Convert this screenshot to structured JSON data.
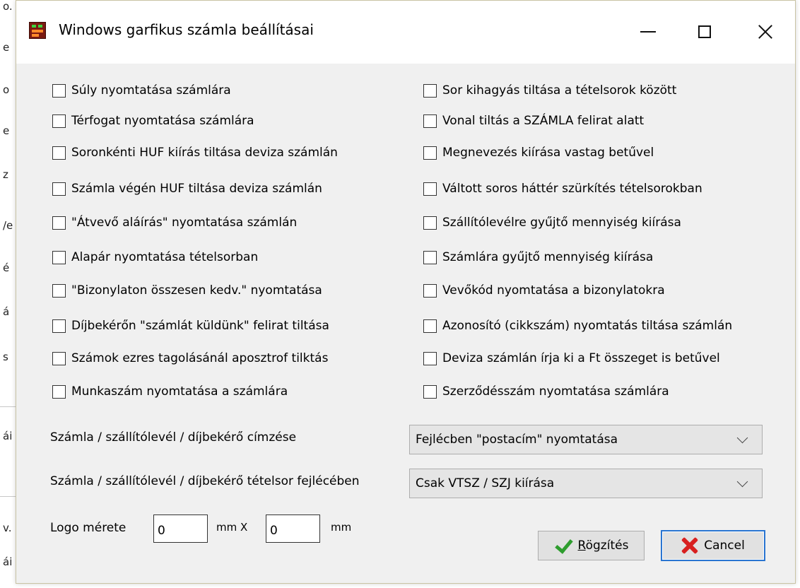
{
  "background_fragments": [
    "o.",
    "e",
    "o",
    "e",
    "z",
    "/e",
    "é",
    "á",
    "s",
    "ái",
    "v.",
    "ái"
  ],
  "dialog": {
    "title": "Windows garfikus számla beállításai",
    "icons": {
      "app": "app-icon",
      "minimize": "minimize-icon",
      "maximize": "maximize-icon",
      "close": "close-icon"
    }
  },
  "checkboxes_left": [
    {
      "label": "Súly nyomtatása számlára",
      "checked": false
    },
    {
      "label": "Térfogat nyomtatása számlára",
      "checked": false
    },
    {
      "label": "Soronkénti HUF kiírás tiltása deviza számlán",
      "checked": false
    },
    {
      "label": "Számla végén HUF tiltása deviza számlán",
      "checked": false
    },
    {
      "label": "\"Átvevő aláírás\" nyomtatása számlán",
      "checked": false
    },
    {
      "label": "Alapár nyomtatása tételsorban",
      "checked": false
    },
    {
      "label": "\"Bizonylaton összesen kedv.\" nyomtatása",
      "checked": false
    },
    {
      "label": "Díjbekérőn \"számlát küldünk\" felirat tiltása",
      "checked": false
    },
    {
      "label": "Számok ezres tagolásánál aposztrof tilktás",
      "checked": false
    },
    {
      "label": "Munkaszám nyomtatása a számlára",
      "checked": false
    }
  ],
  "checkboxes_right": [
    {
      "label": "Sor kihagyás tiltása a tételsorok között",
      "checked": false
    },
    {
      "label": "Vonal tiltás a SZÁMLA felirat alatt",
      "checked": false
    },
    {
      "label": "Megnevezés kiírása vastag betűvel",
      "checked": false
    },
    {
      "label": "Váltott soros háttér szürkítés tételsorokban",
      "checked": false
    },
    {
      "label": "Szállítólevélre gyűjtő mennyiség kiírása",
      "checked": false
    },
    {
      "label": "Számlára gyűjtő mennyiség kiírása",
      "checked": false
    },
    {
      "label": "Vevőkód nyomtatása a bizonylatokra",
      "checked": false
    },
    {
      "label": "Azonosító (cikkszám) nyomtatás tiltása számlán",
      "checked": false
    },
    {
      "label": "Deviza számlán írja ki a Ft összeget is betűvel",
      "checked": false
    },
    {
      "label": "Szerződésszám nyomtatása számlára",
      "checked": false
    }
  ],
  "fields": {
    "addressing_label": "Számla / szállítólevél / díjbekérő címzése",
    "addressing_value": "Fejlécben \"postacím\" nyomtatása",
    "header_label": "Számla / szállítólevél / díjbekérő tételsor fejlécében",
    "header_value": "Csak VTSZ / SZJ kiírása",
    "logo_label": "Logo mérete",
    "logo_width": "0",
    "logo_x_unit": "mm X",
    "logo_height": "0",
    "logo_unit": "mm"
  },
  "buttons": {
    "save_prefix": "R",
    "save_rest": "ögzítés",
    "cancel_label": "Cancel"
  },
  "colors": {
    "dialog_bg": "#f0f0f0",
    "cancel_border": "#2a75d1",
    "check_green": "#2e9d2e",
    "x_red": "#d82020"
  }
}
